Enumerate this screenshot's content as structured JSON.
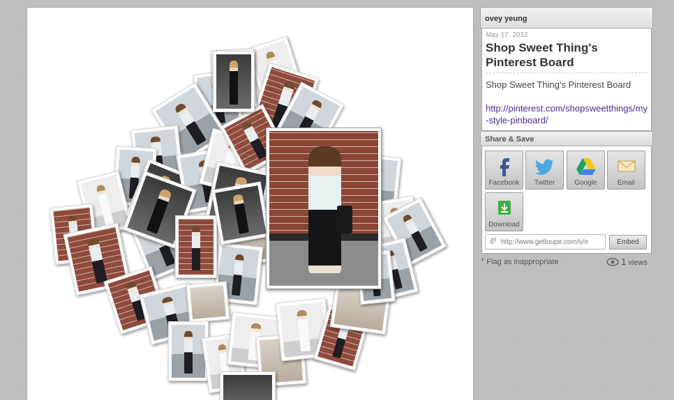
{
  "author": {
    "name": "ovey yeung"
  },
  "post": {
    "date": "May 17, 2012",
    "title": "Shop Sweet Thing's Pinterest Board",
    "description": "Shop Sweet Thing's Pinterest Board",
    "link": "http://pinterest.com/shopsweetthings/my-style-pinboard/"
  },
  "share": {
    "title": "Share & Save",
    "buttons": [
      {
        "label": "Facebook",
        "icon": "facebook-icon"
      },
      {
        "label": "Twitter",
        "icon": "twitter-icon"
      },
      {
        "label": "Google",
        "icon": "google-drive-icon"
      },
      {
        "label": "Email",
        "icon": "email-envelope-icon"
      },
      {
        "label": "Download",
        "icon": "download-arrow-icon"
      }
    ],
    "embed_url": "http://www.getloupe.com/v/e",
    "embed_label": "Embed"
  },
  "footer": {
    "flag_label": "Flag as inappropriate",
    "views_count": "1",
    "views_label": "views"
  },
  "colors": {
    "link": "#4a2b8a",
    "background": "#bdbdbd"
  }
}
